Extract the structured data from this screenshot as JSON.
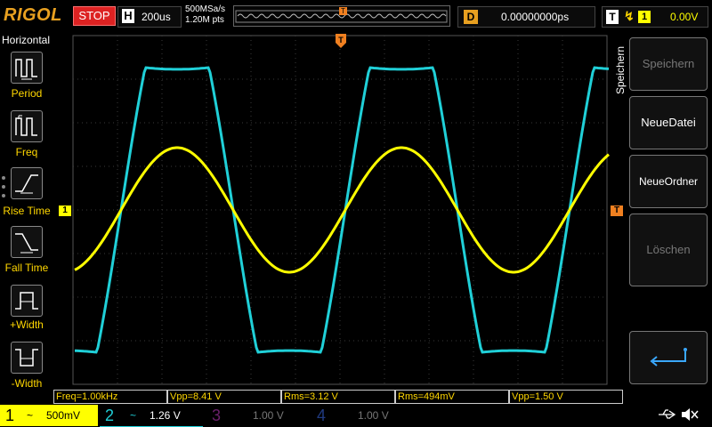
{
  "header": {
    "brand": "RIGOL",
    "run_state": "STOP",
    "horizontal_key": "H",
    "timebase": "200us",
    "sample_rate": "500MSa/s",
    "memory_depth": "1.20M pts",
    "trigger_position_marker": "T",
    "delay_key": "D",
    "delay_value": "0.00000000ps",
    "trigger_key": "T",
    "trigger_source": "1",
    "trigger_level": "0.00V"
  },
  "left_menu": {
    "title": "Horizontal",
    "items": [
      {
        "label": "Period"
      },
      {
        "label": "Freq"
      },
      {
        "label": "Rise Time"
      },
      {
        "label": "Fall Time"
      },
      {
        "label": "+Width"
      },
      {
        "label": "-Width"
      }
    ]
  },
  "right_menu": {
    "title": "Speichern",
    "items": [
      {
        "label": "Speichern"
      },
      {
        "label": "NeueDatei"
      },
      {
        "label": "NeueOrdner"
      },
      {
        "label": "Löschen"
      }
    ]
  },
  "markers": {
    "ch1_ground": "1",
    "trigger_level": "T"
  },
  "measurements": [
    {
      "text": "Freq=1.00kHz"
    },
    {
      "text": "Vpp=8.41 V"
    },
    {
      "text": "Rms=3.12 V"
    },
    {
      "text": "Rms=494mV"
    },
    {
      "text": "Vpp=1.50 V"
    }
  ],
  "channels": [
    {
      "num": "1",
      "coupling": "~",
      "scale": "500mV",
      "color": "#ffff00",
      "active": true
    },
    {
      "num": "2",
      "coupling": "~",
      "scale": "1.26 V",
      "color": "#20d0d8",
      "active": true
    },
    {
      "num": "3",
      "coupling": "",
      "scale": "1.00 V",
      "color": "#c020c0",
      "active": false
    },
    {
      "num": "4",
      "coupling": "",
      "scale": "1.00 V",
      "color": "#3060ff",
      "active": false
    }
  ],
  "status_icons": [
    "usb-icon",
    "speaker-muted-icon"
  ],
  "waveforms": {
    "ch1": {
      "shape": "sine",
      "color": "#ffff00",
      "frequency": "1.00kHz",
      "vpp": "1.50 V"
    },
    "ch2": {
      "shape": "clipped-sine",
      "color": "#20d0d8",
      "vpp": "8.41 V"
    }
  }
}
